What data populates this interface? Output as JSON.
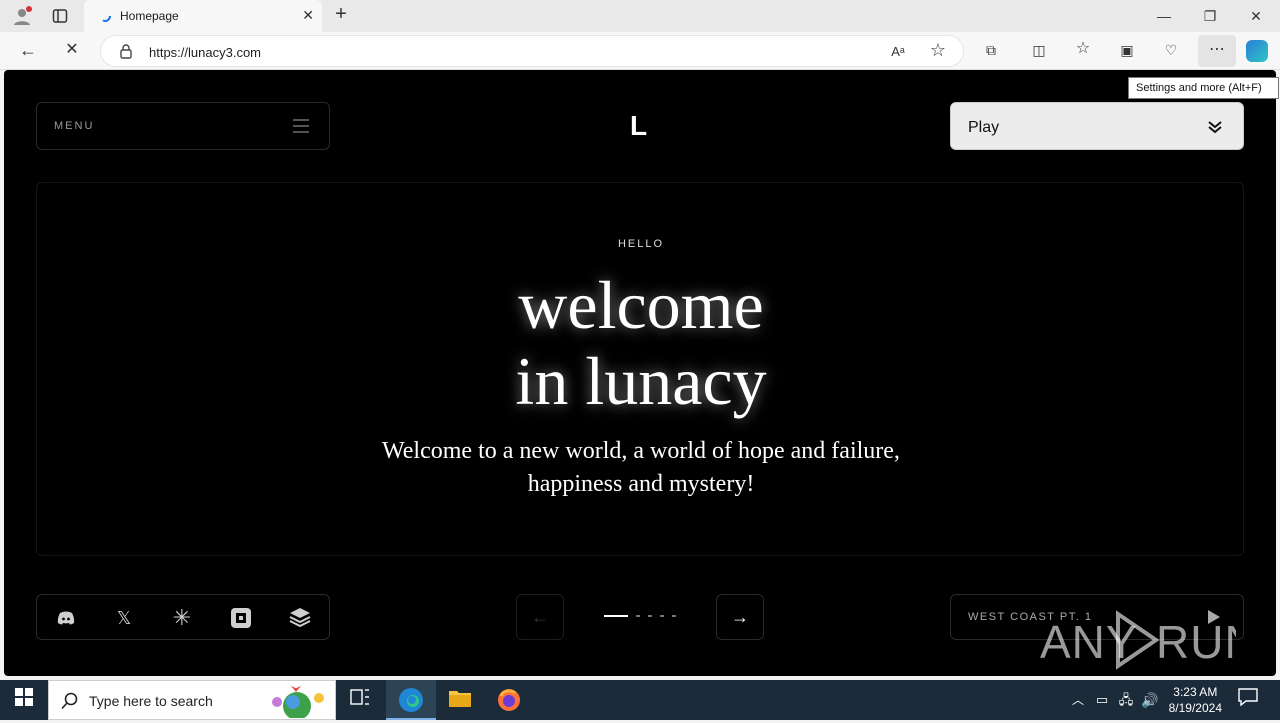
{
  "browser": {
    "tab_title": "Homepage",
    "url": "https://lunacy3.com",
    "tooltip": "Settings and more (Alt+F)"
  },
  "page": {
    "menu_label": "MENU",
    "logo": "L",
    "play_label": "Play",
    "hero_kicker": "HELLO",
    "headline_line1": "welcome",
    "headline_line2": "in lunacy",
    "subtext_line1": "Welcome to a new world, a world of hope and failure,",
    "subtext_line2": "happiness and mystery!",
    "social_icons": [
      "discord-icon",
      "x-icon",
      "asterisk-icon",
      "roblox-icon",
      "stack-icon"
    ],
    "track_label": "WEST COAST PT. 1",
    "slide_count": 5,
    "active_slide": 1
  },
  "watermark": "ANY RUN",
  "taskbar": {
    "search_placeholder": "Type here to search",
    "time": "3:23 AM",
    "date": "8/19/2024"
  }
}
